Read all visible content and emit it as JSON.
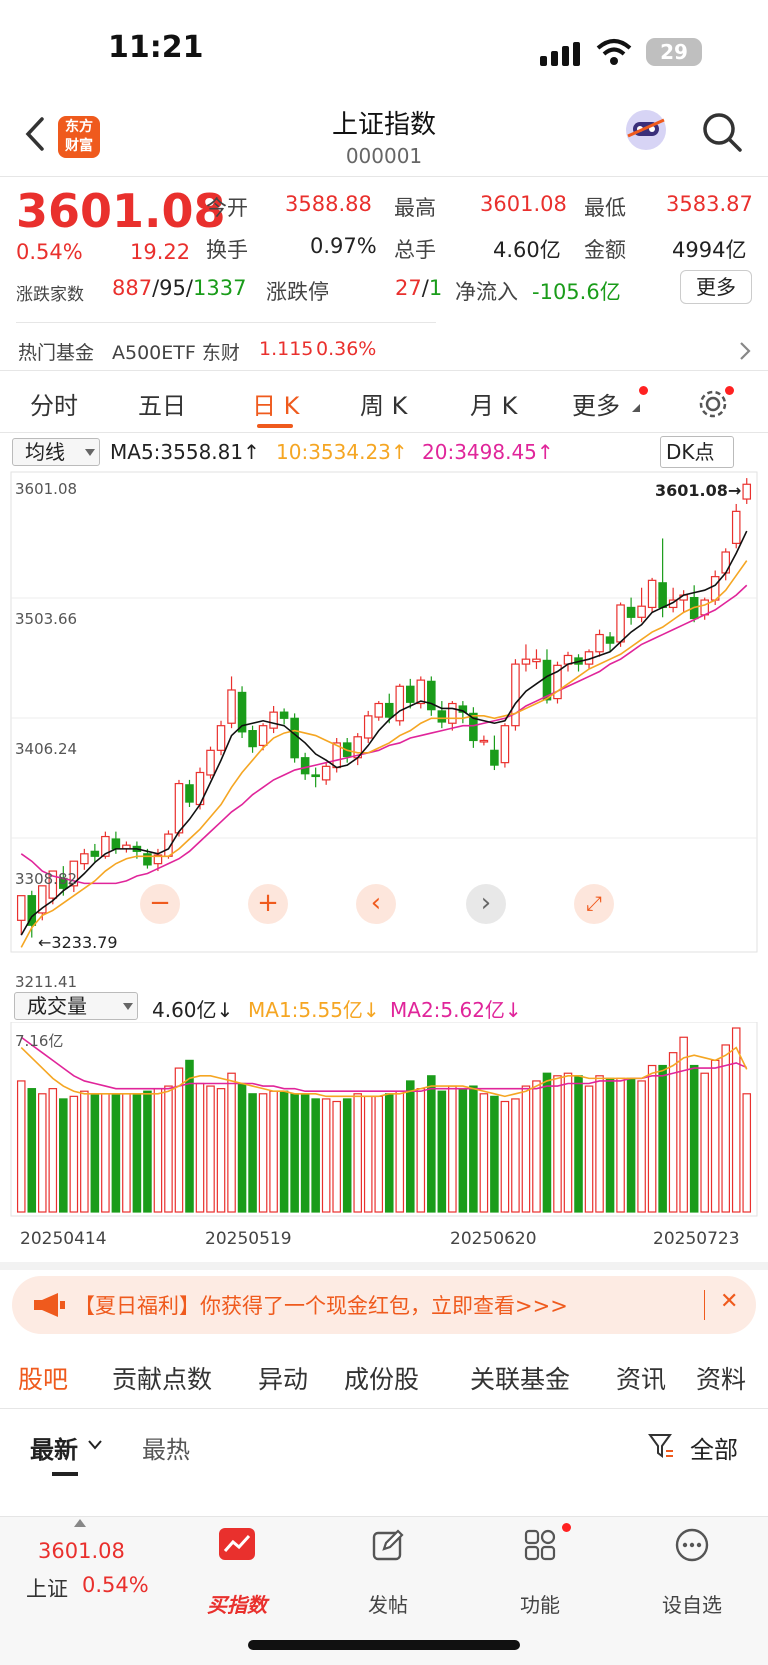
{
  "status_bar": {
    "time": "11:21",
    "battery": "29"
  },
  "header": {
    "title": "上证指数",
    "code": "000001",
    "logo_line1": "东方",
    "logo_line2": "财富"
  },
  "quote": {
    "price": "3601.08",
    "change_pct": "0.54%",
    "change": "19.22",
    "open_label": "今开",
    "open": "3588.88",
    "high_label": "最高",
    "high": "3601.08",
    "low_label": "最低",
    "low": "3583.87",
    "turnover_label": "换手",
    "turnover": "0.97%",
    "volume_label": "总手",
    "volume": "4.60亿",
    "amount_label": "金额",
    "amount": "4994亿",
    "breadth_label": "涨跌家数",
    "breadth_up": "887",
    "breadth_flat": "95",
    "breadth_down": "1337",
    "slash": "/",
    "limit_label": "涨跌停",
    "limit_up": "27",
    "limit_down": "1",
    "inflow_label": "净流入",
    "inflow": "-105.6亿",
    "more": "更多"
  },
  "fund": {
    "label": "热门基金",
    "name": "A500ETF 东财",
    "price": "1.115",
    "pct": "0.36%"
  },
  "tabs": [
    "分时",
    "五日",
    "日 K",
    "周 K",
    "月 K",
    "更多"
  ],
  "kline": {
    "ma_selector": "均线",
    "ma5": "MA5:3558.81↑",
    "ma10": "10:3534.23↑",
    "ma20": "20:3498.45↑",
    "dk": "DK点",
    "y_ticks": [
      "3601.08",
      "3503.66",
      "3406.24",
      "3308.82",
      "3211.41"
    ],
    "last_label": "3601.08→",
    "low_label": "←3233.79",
    "colors": {
      "up": "#e9302d",
      "down": "#1a9c1a",
      "ma5": "#111111",
      "ma10": "#f5a623",
      "ma20": "#e0259a"
    }
  },
  "volume_panel": {
    "selector": "成交量",
    "vol": "4.60亿↓",
    "ma1": "MA1:5.55亿↓",
    "ma2": "MA2:5.62亿↓",
    "max_label": "7.16亿",
    "dates": [
      "20250414",
      "20250519",
      "20250620",
      "20250723"
    ]
  },
  "chart_data": {
    "type": "candlestick",
    "ylim": [
      3211.41,
      3601.08
    ],
    "ohlc": [
      [
        3242,
        3262,
        3230,
        3256
      ],
      [
        3262,
        3238,
        3228,
        3266
      ],
      [
        3248,
        3270,
        3242,
        3266
      ],
      [
        3260,
        3282,
        3255,
        3280
      ],
      [
        3276,
        3268,
        3262,
        3286
      ],
      [
        3270,
        3290,
        3265,
        3288
      ],
      [
        3288,
        3296,
        3283,
        3300
      ],
      [
        3298,
        3294,
        3289,
        3304
      ],
      [
        3294,
        3310,
        3292,
        3314
      ],
      [
        3308,
        3300,
        3296,
        3314
      ],
      [
        3300,
        3303,
        3297,
        3306
      ],
      [
        3302,
        3298,
        3292,
        3306
      ],
      [
        3296,
        3287,
        3284,
        3300
      ],
      [
        3288,
        3295,
        3282,
        3300
      ],
      [
        3294,
        3312,
        3292,
        3315
      ],
      [
        3313,
        3353,
        3310,
        3356
      ],
      [
        3352,
        3338,
        3334,
        3356
      ],
      [
        3336,
        3362,
        3332,
        3366
      ],
      [
        3360,
        3380,
        3357,
        3383
      ],
      [
        3380,
        3400,
        3376,
        3404
      ],
      [
        3402,
        3429,
        3398,
        3440
      ],
      [
        3427,
        3395,
        3390,
        3432
      ],
      [
        3396,
        3383,
        3378,
        3400
      ],
      [
        3384,
        3400,
        3380,
        3402
      ],
      [
        3398,
        3411,
        3394,
        3416
      ],
      [
        3411,
        3406,
        3401,
        3414
      ],
      [
        3406,
        3374,
        3370,
        3410
      ],
      [
        3374,
        3361,
        3356,
        3378
      ],
      [
        3360,
        3359,
        3350,
        3366
      ],
      [
        3356,
        3367,
        3352,
        3370
      ],
      [
        3366,
        3386,
        3362,
        3390
      ],
      [
        3386,
        3375,
        3370,
        3390
      ],
      [
        3374,
        3391,
        3368,
        3394
      ],
      [
        3390,
        3408,
        3386,
        3412
      ],
      [
        3407,
        3418,
        3404,
        3420
      ],
      [
        3418,
        3407,
        3402,
        3426
      ],
      [
        3404,
        3432,
        3400,
        3434
      ],
      [
        3432,
        3419,
        3414,
        3438
      ],
      [
        3418,
        3437,
        3414,
        3440
      ],
      [
        3436,
        3413,
        3408,
        3440
      ],
      [
        3412,
        3403,
        3398,
        3420
      ],
      [
        3402,
        3418,
        3396,
        3420
      ],
      [
        3416,
        3411,
        3402,
        3420
      ],
      [
        3410,
        3388,
        3382,
        3415
      ],
      [
        3388,
        3388,
        3384,
        3392
      ],
      [
        3380,
        3368,
        3364,
        3392
      ],
      [
        3370,
        3400,
        3366,
        3402
      ],
      [
        3400,
        3450,
        3396,
        3454
      ],
      [
        3450,
        3454,
        3444,
        3466
      ],
      [
        3452,
        3454,
        3446,
        3462
      ],
      [
        3453,
        3421,
        3418,
        3462
      ],
      [
        3422,
        3449,
        3418,
        3452
      ],
      [
        3450,
        3457,
        3444,
        3460
      ],
      [
        3455,
        3450,
        3444,
        3458
      ],
      [
        3450,
        3460,
        3446,
        3462
      ],
      [
        3460,
        3474,
        3456,
        3478
      ],
      [
        3472,
        3467,
        3460,
        3476
      ],
      [
        3468,
        3498,
        3464,
        3500
      ],
      [
        3496,
        3488,
        3482,
        3504
      ],
      [
        3488,
        3497,
        3484,
        3512
      ],
      [
        3496,
        3518,
        3492,
        3520
      ],
      [
        3516,
        3496,
        3488,
        3552
      ],
      [
        3496,
        3502,
        3492,
        3512
      ],
      [
        3502,
        3506,
        3492,
        3510
      ],
      [
        3504,
        3487,
        3484,
        3514
      ],
      [
        3490,
        3502,
        3486,
        3504
      ],
      [
        3502,
        3521,
        3498,
        3526
      ],
      [
        3524,
        3541,
        3518,
        3544
      ],
      [
        3548,
        3574,
        3544,
        3580
      ],
      [
        3584,
        3596,
        3580,
        3601
      ]
    ],
    "ma5": [
      3230,
      3245,
      3252,
      3258,
      3266,
      3272,
      3280,
      3289,
      3296,
      3300,
      3300,
      3300,
      3298,
      3296,
      3300,
      3314,
      3324,
      3336,
      3354,
      3372,
      3392,
      3400,
      3402,
      3404,
      3402,
      3400,
      3393,
      3386,
      3377,
      3372,
      3366,
      3368,
      3374,
      3384,
      3396,
      3405,
      3412,
      3416,
      3420,
      3418,
      3414,
      3414,
      3412,
      3406,
      3404,
      3402,
      3404,
      3418,
      3428,
      3434,
      3440,
      3444,
      3450,
      3452,
      3454,
      3457,
      3460,
      3468,
      3476,
      3482,
      3492,
      3496,
      3500,
      3506,
      3508,
      3510,
      3514,
      3524,
      3540,
      3558
    ],
    "ma10": [
      3220,
      3236,
      3246,
      3250,
      3256,
      3262,
      3268,
      3274,
      3282,
      3288,
      3292,
      3294,
      3294,
      3294,
      3294,
      3300,
      3308,
      3316,
      3326,
      3336,
      3350,
      3362,
      3372,
      3382,
      3390,
      3394,
      3396,
      3394,
      3392,
      3388,
      3384,
      3380,
      3378,
      3378,
      3382,
      3386,
      3392,
      3396,
      3402,
      3406,
      3406,
      3406,
      3406,
      3408,
      3408,
      3406,
      3408,
      3410,
      3414,
      3418,
      3422,
      3428,
      3434,
      3440,
      3446,
      3450,
      3454,
      3458,
      3464,
      3470,
      3476,
      3480,
      3486,
      3492,
      3496,
      3498,
      3502,
      3510,
      3522,
      3534
    ],
    "ma20": [
      3296,
      3290,
      3282,
      3278,
      3276,
      3274,
      3272,
      3272,
      3272,
      3272,
      3274,
      3278,
      3280,
      3284,
      3288,
      3292,
      3298,
      3306,
      3314,
      3322,
      3330,
      3336,
      3344,
      3350,
      3356,
      3360,
      3364,
      3366,
      3368,
      3370,
      3372,
      3374,
      3376,
      3378,
      3380,
      3384,
      3386,
      3390,
      3392,
      3394,
      3396,
      3398,
      3400,
      3400,
      3402,
      3404,
      3406,
      3410,
      3416,
      3420,
      3424,
      3428,
      3432,
      3436,
      3440,
      3444,
      3450,
      3454,
      3460,
      3466,
      3470,
      3474,
      3478,
      3482,
      3486,
      3490,
      3494,
      3500,
      3506,
      3514
    ],
    "volume": [
      5.1,
      4.8,
      4.6,
      4.8,
      4.4,
      4.5,
      4.7,
      4.6,
      4.6,
      4.6,
      4.6,
      4.6,
      4.7,
      4.8,
      4.9,
      5.6,
      5.9,
      5.0,
      4.9,
      4.8,
      5.4,
      5.0,
      4.6,
      4.6,
      4.7,
      4.7,
      4.6,
      4.6,
      4.4,
      4.4,
      4.3,
      4.4,
      4.6,
      4.5,
      4.5,
      4.6,
      4.7,
      5.1,
      4.8,
      5.3,
      4.7,
      4.9,
      4.8,
      4.9,
      4.6,
      4.5,
      4.3,
      4.4,
      4.9,
      5.1,
      5.4,
      5.3,
      5.4,
      5.3,
      4.9,
      5.3,
      5.2,
      5.2,
      5.2,
      5.1,
      5.7,
      5.7,
      6.2,
      6.8,
      5.7,
      5.4,
      5.9,
      6.5,
      7.16,
      4.6
    ],
    "vol_ma1": [
      6.4,
      6.0,
      5.6,
      5.2,
      4.9,
      4.7,
      4.6,
      4.6,
      4.6,
      4.6,
      4.6,
      4.6,
      4.6,
      4.6,
      4.7,
      4.9,
      5.2,
      5.3,
      5.3,
      5.2,
      5.1,
      5.0,
      4.9,
      4.8,
      4.7,
      4.7,
      4.6,
      4.6,
      4.6,
      4.5,
      4.5,
      4.5,
      4.5,
      4.5,
      4.5,
      4.6,
      4.6,
      4.7,
      4.8,
      4.9,
      4.9,
      4.9,
      4.9,
      4.8,
      4.7,
      4.6,
      4.5,
      4.6,
      4.7,
      4.9,
      5.1,
      5.2,
      5.3,
      5.3,
      5.2,
      5.2,
      5.2,
      5.2,
      5.2,
      5.2,
      5.4,
      5.5,
      5.7,
      6.0,
      6.1,
      6.0,
      5.9,
      6.1,
      6.4,
      5.55
    ],
    "vol_ma2": [
      6.8,
      6.5,
      6.2,
      5.9,
      5.6,
      5.3,
      5.1,
      5.0,
      4.9,
      4.8,
      4.8,
      4.8,
      4.8,
      4.8,
      4.8,
      4.9,
      5.0,
      5.0,
      5.0,
      5.0,
      5.0,
      5.0,
      5.0,
      4.9,
      4.9,
      4.8,
      4.8,
      4.7,
      4.7,
      4.7,
      4.7,
      4.7,
      4.7,
      4.7,
      4.7,
      4.7,
      4.7,
      4.7,
      4.7,
      4.8,
      4.8,
      4.8,
      4.8,
      4.8,
      4.8,
      4.8,
      4.8,
      4.8,
      4.8,
      4.8,
      4.9,
      4.9,
      5.0,
      5.0,
      5.0,
      5.1,
      5.1,
      5.1,
      5.2,
      5.2,
      5.3,
      5.3,
      5.4,
      5.5,
      5.6,
      5.6,
      5.6,
      5.7,
      5.8,
      5.62
    ]
  },
  "banner": {
    "text": "【夏日福利】你获得了一个现金红包，立即查看>>>",
    "close": "✕"
  },
  "subtabs": [
    "股吧",
    "贡献点数",
    "异动",
    "成份股",
    "关联基金",
    "资讯",
    "资料"
  ],
  "subfilter": {
    "latest": "最新",
    "hot": "最热",
    "all": "全部"
  },
  "bottom_nav": {
    "price": "3601.08",
    "market": "上证",
    "pct": "0.54%",
    "buy": "买指数",
    "post": "发帖",
    "func": "功能",
    "watch": "设自选"
  }
}
